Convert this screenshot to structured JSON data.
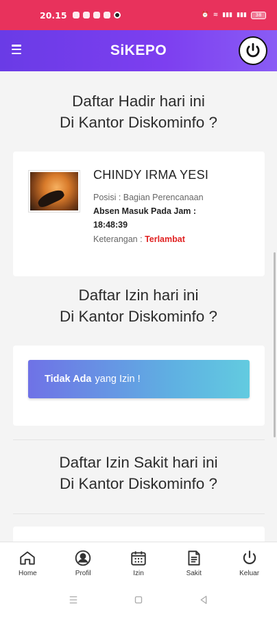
{
  "status_bar": {
    "time": "20.15",
    "battery": "38"
  },
  "header": {
    "title": "SiKEPO"
  },
  "attendance": {
    "title_line1": "Daftar Hadir hari ini",
    "title_line2": "Di Kantor Diskominfo ?",
    "entry": {
      "name": "CHINDY IRMA YESI",
      "position": "Posisi : Bagian Perencanaan",
      "check_in_label": "Absen Masuk Pada Jam :",
      "check_in_time": "18:48:39",
      "note_label": "Keterangan : ",
      "note_value": "Terlambat"
    }
  },
  "leave": {
    "title_line1": "Daftar Izin hari ini",
    "title_line2": "Di Kantor Diskominfo ?",
    "empty_bold": "Tidak Ada",
    "empty_rest": "yang Izin !"
  },
  "sick_leave": {
    "title_line1": "Daftar Izin Sakit hari ini",
    "title_line2": "Di Kantor Diskominfo ?"
  },
  "bottom_nav": [
    {
      "label": "Home",
      "icon": "home-icon"
    },
    {
      "label": "Profil",
      "icon": "profile-icon"
    },
    {
      "label": "Izin",
      "icon": "calendar-icon"
    },
    {
      "label": "Sakit",
      "icon": "document-icon"
    },
    {
      "label": "Keluar",
      "icon": "power-icon"
    }
  ],
  "colors": {
    "status_bar": "#e8325c",
    "header": "#7d3ff0",
    "late": "#e02020"
  }
}
